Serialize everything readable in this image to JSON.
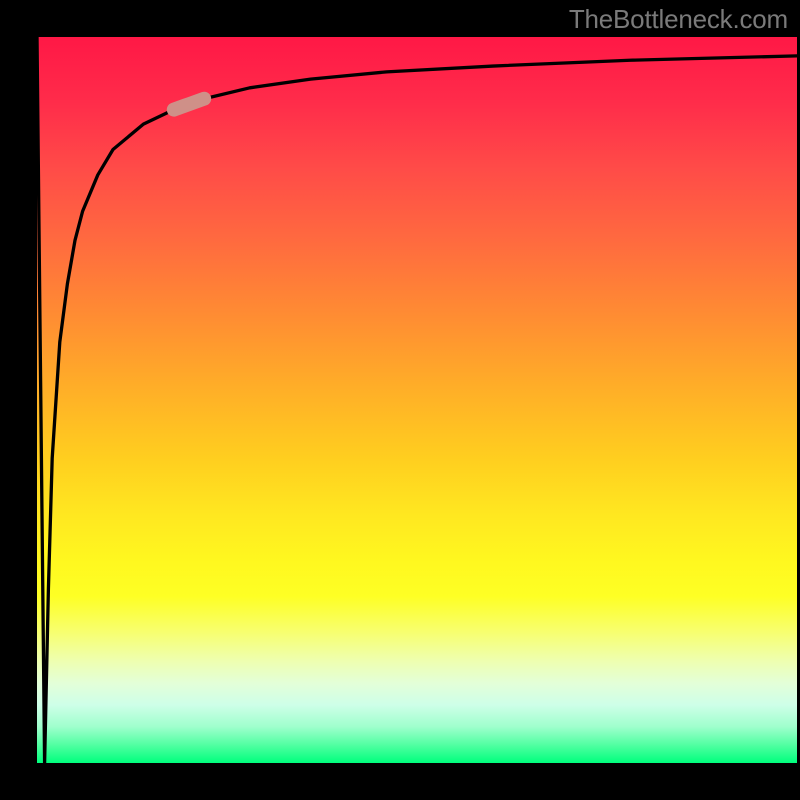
{
  "attribution": "TheBottleneck.com",
  "chart_data": {
    "type": "line",
    "title": "",
    "xlabel": "",
    "ylabel": "",
    "xlim": [
      0,
      100
    ],
    "ylim": [
      0,
      100
    ],
    "series": [
      {
        "name": "bottleneck-curve",
        "x": [
          0,
          1,
          1.5,
          2,
          3,
          4,
          5,
          6,
          8,
          10,
          14,
          18,
          22,
          28,
          36,
          46,
          60,
          78,
          100
        ],
        "y": [
          100,
          0,
          24,
          42,
          58,
          66,
          72,
          76,
          81,
          84.5,
          88,
          90,
          91.5,
          93,
          94.2,
          95.2,
          96,
          96.8,
          97.4
        ]
      }
    ],
    "marker": {
      "series": "bottleneck-curve",
      "x_range": [
        18,
        22
      ],
      "color": "#cf9088"
    },
    "background_gradient": {
      "top": "#ff1846",
      "mid": "#ffe820",
      "bottom": "#00ff7d"
    }
  }
}
